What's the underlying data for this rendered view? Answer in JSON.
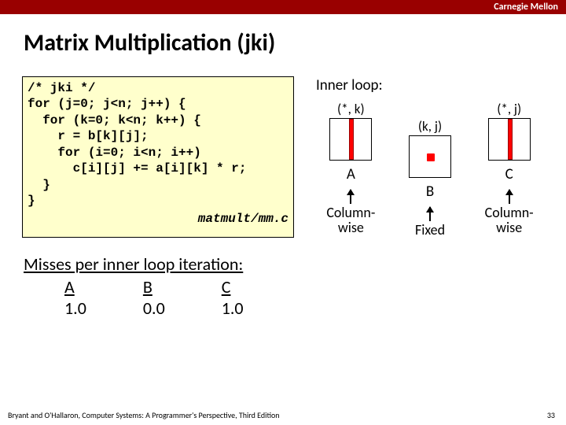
{
  "header": {
    "institution": "Carnegie Mellon"
  },
  "title": "Matrix Multiplication (jki)",
  "code": {
    "lines": "/* jki */\nfor (j=0; j<n; j++) {\n  for (k=0; k<n; k++) {\n    r = b[k][j];\n    for (i=0; i<n; i++)\n      c[i][j] += a[i][k] * r;\n  }\n}",
    "filename": "matmult/mm.c"
  },
  "diagram": {
    "label": "Inner loop:",
    "matrices": [
      {
        "coord": "(*, k)",
        "name": "A",
        "access_l1": "Column-",
        "access_l2": "wise"
      },
      {
        "coord": "(k, j)",
        "name": "B",
        "access_l1": "Fixed",
        "access_l2": ""
      },
      {
        "coord": "(*, j)",
        "name": "C",
        "access_l1": "Column-",
        "access_l2": "wise"
      }
    ]
  },
  "misses": {
    "title": "Misses per inner loop iteration:",
    "cols": [
      {
        "head": "A",
        "val": "1.0"
      },
      {
        "head": "B",
        "val": "0.0"
      },
      {
        "head": "C",
        "val": "1.0"
      }
    ]
  },
  "footer": {
    "credit": "Bryant and O'Hallaron, Computer Systems: A Programmer's Perspective, Third Edition",
    "page": "33"
  }
}
